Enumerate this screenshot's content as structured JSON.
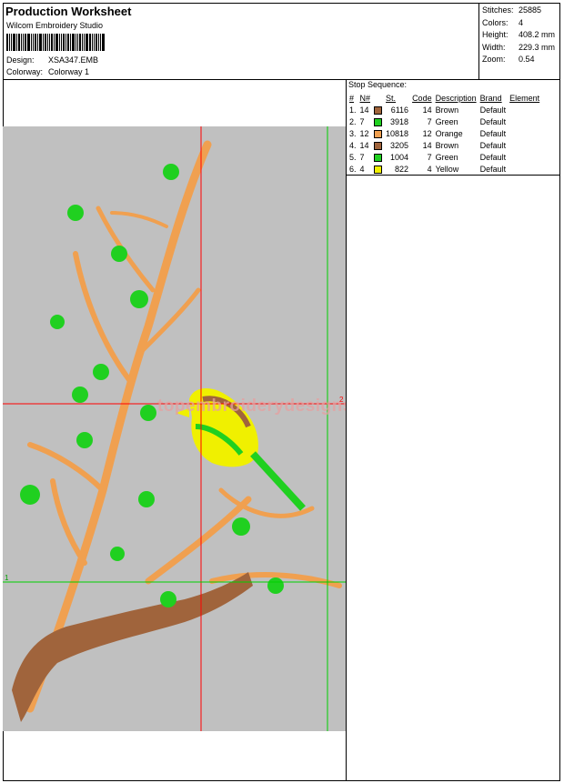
{
  "header": {
    "title": "Production Worksheet",
    "software": "Wilcom Embroidery Studio",
    "design_label": "Design:",
    "design_value": "XSA347.EMB",
    "colorway_label": "Colorway:",
    "colorway_value": "Colorway 1"
  },
  "stats": [
    {
      "label": "Stitches:",
      "value": "25885"
    },
    {
      "label": "Colors:",
      "value": "4"
    },
    {
      "label": "Height:",
      "value": "408.2 mm"
    },
    {
      "label": "Width:",
      "value": "229.3 mm"
    },
    {
      "label": "Zoom:",
      "value": "0.54"
    }
  ],
  "stop_sequence": {
    "title": "Stop Sequence:",
    "headers": [
      "#",
      "N#",
      "St.",
      "Code",
      "Description",
      "Brand",
      "Element"
    ],
    "rows": [
      {
        "num": "1.",
        "n": "14",
        "color": "#a0643c",
        "stitches": "6116",
        "code": "14",
        "description": "Brown",
        "brand": "Default",
        "element": ""
      },
      {
        "num": "2.",
        "n": "7",
        "color": "#20d020",
        "stitches": "3918",
        "code": "7",
        "description": "Green",
        "brand": "Default",
        "element": ""
      },
      {
        "num": "3.",
        "n": "12",
        "color": "#f0a050",
        "stitches": "10818",
        "code": "12",
        "description": "Orange",
        "brand": "Default",
        "element": ""
      },
      {
        "num": "4.",
        "n": "14",
        "color": "#a0643c",
        "stitches": "3205",
        "code": "14",
        "description": "Brown",
        "brand": "Default",
        "element": ""
      },
      {
        "num": "5.",
        "n": "7",
        "color": "#20d020",
        "stitches": "1004",
        "code": "7",
        "description": "Green",
        "brand": "Default",
        "element": ""
      },
      {
        "num": "6.",
        "n": "4",
        "color": "#f0f000",
        "stitches": "822",
        "code": "4",
        "description": "Yellow",
        "brand": "Default",
        "element": ""
      }
    ]
  },
  "design_view": {
    "watermark": "topembroiderydesigns.com",
    "axis_marker_h": "2",
    "axis_marker_v": "1",
    "background": "#c0c0c0",
    "thread_colors": {
      "brown": "#a0643c",
      "green": "#20d020",
      "orange": "#f0a050",
      "yellow": "#f0f000"
    }
  }
}
